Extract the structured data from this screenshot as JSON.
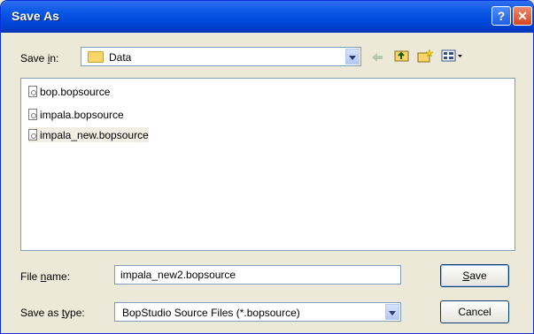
{
  "window": {
    "title": "Save As",
    "help_glyph": "?",
    "close_glyph": "✕"
  },
  "save_in": {
    "label_pre": "Save ",
    "label_accel": "i",
    "label_post": "n:",
    "value": "Data",
    "folder_icon": "folder-icon"
  },
  "toolbar": {
    "back_icon": "back-arrow-icon",
    "up_icon": "up-folder-icon",
    "new_folder_icon": "new-folder-icon",
    "views_icon": "views-menu-icon"
  },
  "files": [
    {
      "name": "bop.bopsource",
      "selected": false
    },
    {
      "name": "impala.bopsource",
      "selected": false
    },
    {
      "name": "impala_new.bopsource",
      "selected": true
    }
  ],
  "file_name": {
    "label_pre": "File ",
    "label_accel": "n",
    "label_post": "ame:",
    "value": "impala_new2.bopsource"
  },
  "save_type": {
    "label_pre": "Save as ",
    "label_accel": "t",
    "label_post": "ype:",
    "value": "BopStudio Source Files (*.bopsource)"
  },
  "buttons": {
    "save_accel": "S",
    "save_rest": "ave",
    "cancel": "Cancel"
  }
}
